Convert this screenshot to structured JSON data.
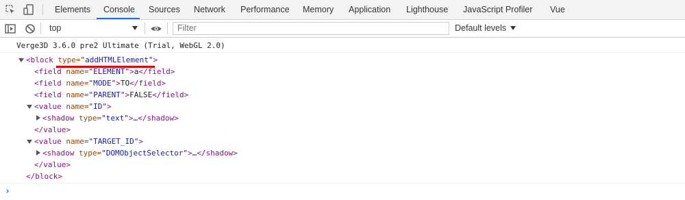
{
  "tabs": [
    {
      "label": "Elements"
    },
    {
      "label": "Console"
    },
    {
      "label": "Sources"
    },
    {
      "label": "Network"
    },
    {
      "label": "Performance"
    },
    {
      "label": "Memory"
    },
    {
      "label": "Application"
    },
    {
      "label": "Lighthouse"
    },
    {
      "label": "JavaScript Profiler"
    },
    {
      "label": "Vue"
    }
  ],
  "active_tab": "Console",
  "toolbar": {
    "context": "top",
    "filter_placeholder": "Filter",
    "levels": "Default levels"
  },
  "console": {
    "banner": "Verge3D 3.6.0 pre2 Ultimate (Trial, WebGL 2.0)",
    "block": {
      "open_tag": "<block",
      "type_attr": "type=",
      "type_value": "\"addHTMLElement\"",
      "close": ">",
      "end_tag": "</block>"
    },
    "fields": [
      {
        "open": "<field",
        "attr": "name=",
        "name": "\"ELEMENT\"",
        "gt": ">",
        "text": "a",
        "close": "</field>"
      },
      {
        "open": "<field",
        "attr": "name=",
        "name": "\"MODE\"",
        "gt": ">",
        "text": "TO",
        "close": "</field>"
      },
      {
        "open": "<field",
        "attr": "name=",
        "name": "\"PARENT\"",
        "gt": ">",
        "text": "FALSE",
        "close": "</field>"
      }
    ],
    "values": [
      {
        "open": "<value",
        "attr": "name=",
        "name": "\"ID\"",
        "gt": ">",
        "shadow": {
          "open": "<shadow",
          "attr": "type=",
          "type": "\"text\"",
          "gt": ">",
          "ellipsis": "…",
          "close": "</shadow>"
        },
        "end": "</value>"
      },
      {
        "open": "<value",
        "attr": "name=",
        "name": "\"TARGET_ID\"",
        "gt": ">",
        "shadow": {
          "open": "<shadow",
          "attr": "type=",
          "type": "\"DOMObjectSelector\"",
          "gt": ">",
          "ellipsis": "…",
          "close": "</shadow>"
        },
        "end": "</value>"
      }
    ],
    "prompt": "›"
  },
  "colors": {
    "accent": "#1a73e8",
    "tag": "#881280",
    "attr": "#994500",
    "value": "#1a1aa6",
    "highlight": "#e00000"
  }
}
